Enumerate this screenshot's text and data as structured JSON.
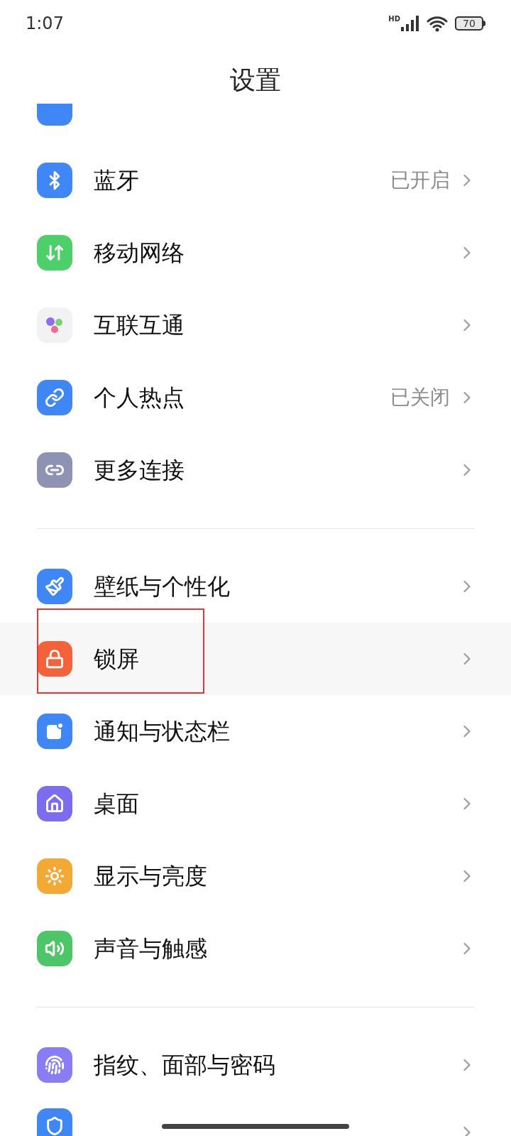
{
  "status_bar": {
    "time": "1:07",
    "network_badge": "HD",
    "battery": "70"
  },
  "title": "设置",
  "groups": [
    {
      "items": [
        {
          "label": "蓝牙",
          "value": "已开启",
          "highlighted": false
        },
        {
          "label": "移动网络",
          "highlighted": false
        },
        {
          "label": "互联互通",
          "highlighted": false
        },
        {
          "label": "个人热点",
          "value": "已关闭",
          "highlighted": false
        },
        {
          "label": "更多连接",
          "highlighted": false
        }
      ]
    },
    {
      "items": [
        {
          "label": "壁纸与个性化",
          "highlighted": false
        },
        {
          "label": "锁屏",
          "highlighted": true
        },
        {
          "label": "通知与状态栏",
          "highlighted": false
        },
        {
          "label": "桌面",
          "highlighted": false
        },
        {
          "label": "显示与亮度",
          "highlighted": false
        },
        {
          "label": "声音与触感",
          "highlighted": false
        }
      ]
    },
    {
      "items": [
        {
          "label": "指纹、面部与密码",
          "highlighted": false
        }
      ]
    }
  ]
}
